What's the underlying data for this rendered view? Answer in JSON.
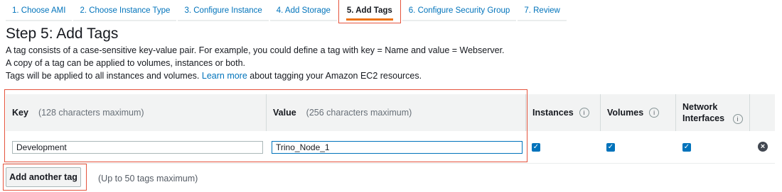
{
  "wizard": {
    "tabs": [
      {
        "label": "1. Choose AMI"
      },
      {
        "label": "2. Choose Instance Type"
      },
      {
        "label": "3. Configure Instance"
      },
      {
        "label": "4. Add Storage"
      },
      {
        "label": "5. Add Tags",
        "active": true
      },
      {
        "label": "6. Configure Security Group"
      },
      {
        "label": "7. Review"
      }
    ]
  },
  "page": {
    "title": "Step 5: Add Tags",
    "desc1": "A tag consists of a case-sensitive key-value pair. For example, you could define a tag with key = Name and value = Webserver.",
    "desc2": "A copy of a tag can be applied to volumes, instances or both.",
    "desc3_prefix": "Tags will be applied to all instances and volumes.",
    "learn_more": "Learn more",
    "desc3_suffix": "about tagging your Amazon EC2 resources."
  },
  "table": {
    "key_header": "Key",
    "key_hint": "(128 characters maximum)",
    "value_header": "Value",
    "value_hint": "(256 characters maximum)",
    "instances_header": "Instances",
    "volumes_header": "Volumes",
    "network_header_line1": "Network",
    "network_header_line2": "Interfaces",
    "info_glyph": "i",
    "rows": [
      {
        "key": "Development",
        "value": "Trino_Node_1",
        "instances": true,
        "volumes": true,
        "network_interfaces": true
      }
    ]
  },
  "footer": {
    "add_button": "Add another tag",
    "max_note": "(Up to 50 tags maximum)"
  },
  "colors": {
    "link": "#0073bb",
    "highlight": "#e5543d",
    "active_tab_underline": "#ec7211",
    "header_bg": "#f2f3f3",
    "checkbox": "#0073bb"
  }
}
